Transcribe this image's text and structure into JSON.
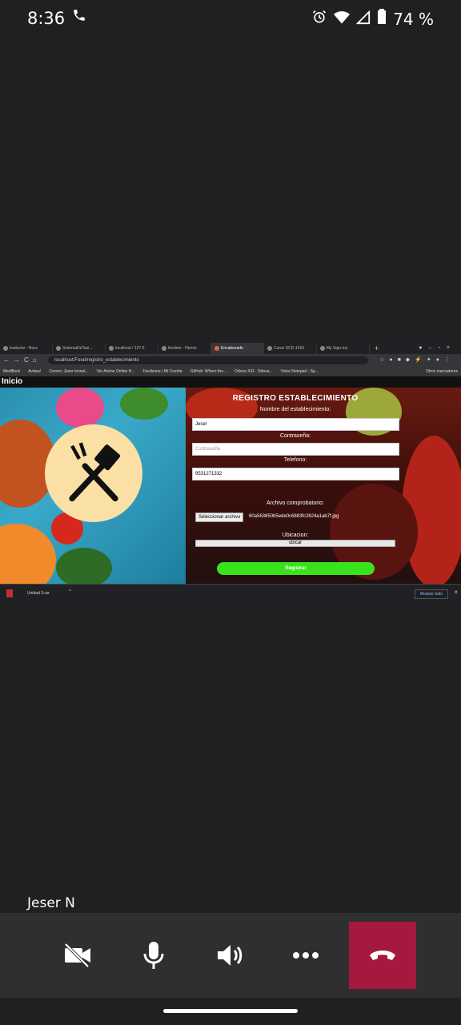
{
  "statusbar": {
    "time": "8:36",
    "battery": "74 %"
  },
  "browser": {
    "tabs": [
      {
        "label": "traductor - Busc"
      },
      {
        "label": "SistemaDeTaxi..."
      },
      {
        "label": "localhost / 127.0"
      },
      {
        "label": "foodme - Herois"
      },
      {
        "label": "Encabezado"
      },
      {
        "label": "Curso SCD-1010"
      },
      {
        "label": "My Sign-ins"
      }
    ],
    "url": "localhost/Food/registro_establecimiento",
    "bookmarks": [
      {
        "label": "Mediflock"
      },
      {
        "label": "Aviáus!"
      },
      {
        "label": "Correo: Jeser leonel..."
      },
      {
        "label": "Ver Anime Online H..."
      },
      {
        "label": "Feedzone | Mi Cuenta"
      },
      {
        "label": "GitHub: Where the..."
      },
      {
        "label": "Odoxa XXI - Odoxa..."
      },
      {
        "label": "Voice Notepad - Sp..."
      }
    ],
    "other_bookmarks": "Otros marcadores"
  },
  "page": {
    "header": "Inicio",
    "form": {
      "title": "REGISTRO ESTABLECIMIENTO",
      "name_label": "Nombre del establecimiento:",
      "name_value": "Jeser",
      "password_label": "Contraseña:",
      "password_placeholder": "Contraseña",
      "phone_label": "Telefono:",
      "phone_value": "9531271332",
      "file_label": "Archivo comprobatorio:",
      "file_button": "Seleccionar archivo",
      "file_name": "60a563850b5ede0c6883fc2624a1ab7f.jpg",
      "location_label": "Ubicacion:",
      "location_button": "ubicar",
      "submit": "Registrar"
    }
  },
  "downloads": {
    "file": "Unidad 3.rar",
    "show_all": "Mostrar todo"
  },
  "call": {
    "caller": "Jeser N"
  },
  "colors": {
    "end_call": "#a4193d",
    "submit": "#39e21c"
  }
}
